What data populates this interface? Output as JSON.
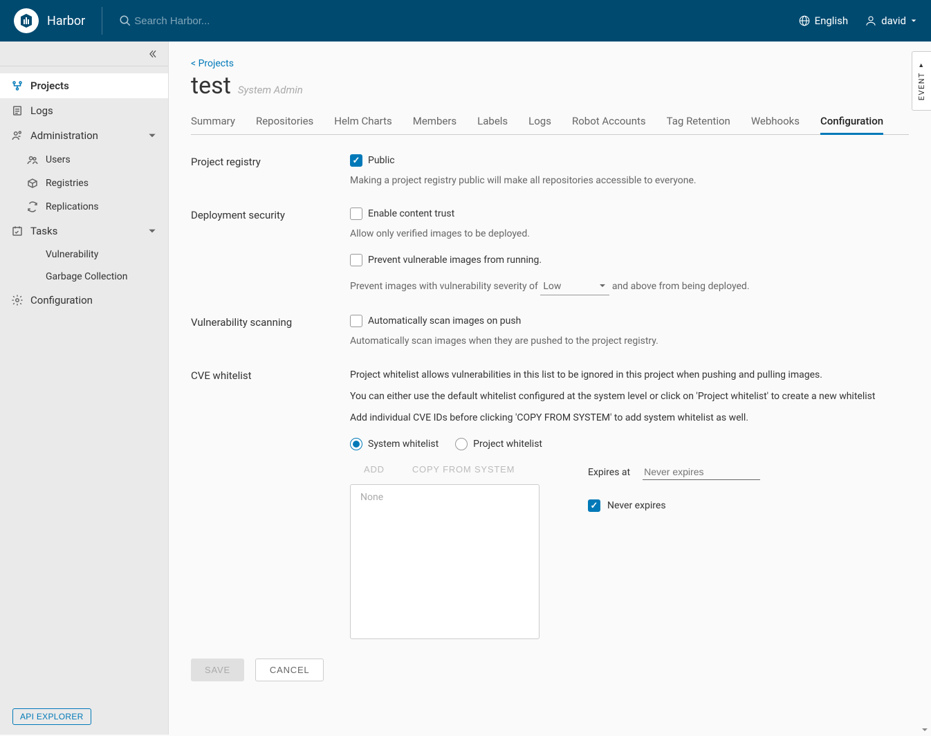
{
  "header": {
    "brand": "Harbor",
    "search_placeholder": "Search Harbor...",
    "language": "English",
    "user": "david"
  },
  "sidebar": {
    "projects": "Projects",
    "logs": "Logs",
    "administration": "Administration",
    "users": "Users",
    "registries": "Registries",
    "replications": "Replications",
    "tasks": "Tasks",
    "vulnerability": "Vulnerability",
    "garbage": "Garbage Collection",
    "configuration": "Configuration",
    "api_explorer": "API EXPLORER"
  },
  "breadcrumb": {
    "projects_link": "< Projects"
  },
  "project": {
    "name": "test",
    "role": "System Admin"
  },
  "tabs": {
    "summary": "Summary",
    "repositories": "Repositories",
    "helm": "Helm Charts",
    "members": "Members",
    "labels": "Labels",
    "logs": "Logs",
    "robot": "Robot Accounts",
    "tag": "Tag Retention",
    "webhooks": "Webhooks",
    "configuration": "Configuration"
  },
  "config": {
    "project_registry": {
      "label": "Project registry",
      "public": "Public",
      "help": "Making a project registry public will make all repositories accessible to everyone."
    },
    "deploy": {
      "label": "Deployment security",
      "content_trust": "Enable content trust",
      "content_trust_help": "Allow only verified images to be deployed.",
      "prevent_vuln": "Prevent vulnerable images from running.",
      "prevent_prefix": "Prevent images with vulnerability severity of",
      "severity": "Low",
      "prevent_suffix": "and above from being deployed."
    },
    "vuln_scan": {
      "label": "Vulnerability scanning",
      "auto_scan": "Automatically scan images on push",
      "help": "Automatically scan images when they are pushed to the project registry."
    },
    "cve": {
      "label": "CVE whitelist",
      "p1": "Project whitelist allows vulnerabilities in this list to be ignored in this project when pushing and pulling images.",
      "p2": "You can either use the default whitelist configured at the system level or click on 'Project whitelist' to create a new whitelist",
      "p3": "Add individual CVE IDs before clicking 'COPY FROM SYSTEM' to add system whitelist as well.",
      "system_wl": "System whitelist",
      "project_wl": "Project whitelist",
      "add": "ADD",
      "copy_from_system": "COPY FROM SYSTEM",
      "none": "None",
      "expires_at": "Expires at",
      "never_expires_field": "Never expires",
      "never_expires_chk": "Never expires"
    },
    "save": "SAVE",
    "cancel": "CANCEL"
  },
  "event_tab": "EVENT"
}
